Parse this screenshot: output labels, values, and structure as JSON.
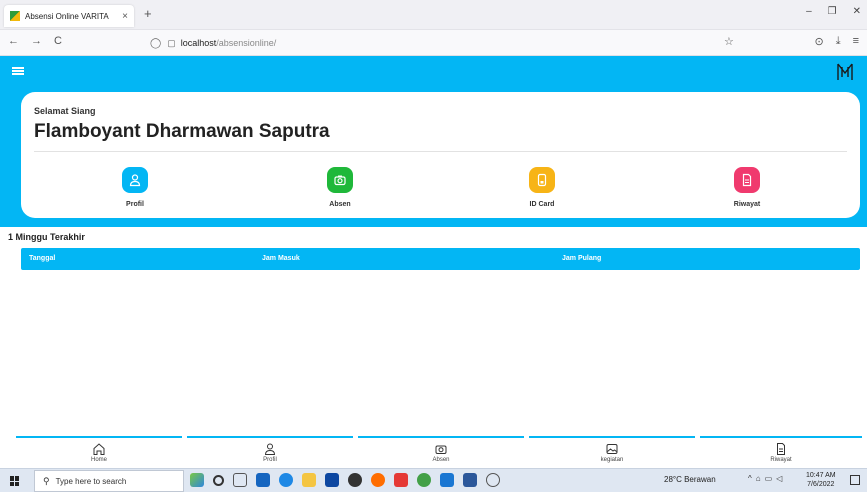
{
  "browser": {
    "tab_title": "Absensi Online VARITA",
    "tab_close": "×",
    "new_tab": "+",
    "url_host": "localhost",
    "url_path": "/absensionline/",
    "nav": {
      "back": "←",
      "forward": "→",
      "reload": "C"
    },
    "window_controls": {
      "minimize": "–",
      "restore": "❐",
      "close": "✕"
    },
    "tools": {
      "bookmark": "☆",
      "pocket": "⊙",
      "download": "⤓",
      "menu": "≡"
    }
  },
  "app": {
    "accent_color": "#03b6f4",
    "greeting": "Selamat Siang",
    "user_name": "Flamboyant Dharmawan Saputra",
    "menu": [
      {
        "label": "Profil",
        "icon": "person-icon",
        "color": "#03b6f4"
      },
      {
        "label": "Absen",
        "icon": "camera-icon",
        "color": "#1fb83a"
      },
      {
        "label": "ID Card",
        "icon": "id-card-icon",
        "color": "#f7b416"
      },
      {
        "label": "Riwayat",
        "icon": "document-icon",
        "color": "#f03a6e"
      }
    ],
    "history": {
      "section_title": "1 Minggu Terakhir",
      "columns": [
        "Tanggal",
        "Jam Masuk",
        "Jam Pulang"
      ]
    },
    "bottom_nav": [
      {
        "label": "Home",
        "icon": "home-icon"
      },
      {
        "label": "Profil",
        "icon": "person-icon"
      },
      {
        "label": "Absen",
        "icon": "camera-icon"
      },
      {
        "label": "kegiatan",
        "icon": "gallery-icon"
      },
      {
        "label": "Riwayat",
        "icon": "document-icon"
      }
    ]
  },
  "taskbar": {
    "search_placeholder": "Type here to search",
    "weather": "28°C Berawan",
    "time": "10:47 AM",
    "date": "7/6/2022"
  }
}
